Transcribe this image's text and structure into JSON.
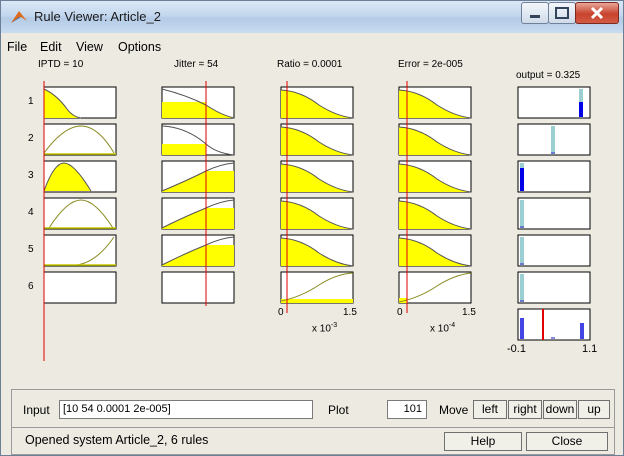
{
  "window": {
    "title": "Rule Viewer: Article_2",
    "icon": "matlab-icon",
    "controls": [
      "minimize-icon",
      "maximize-icon",
      "close-icon"
    ]
  },
  "menu": [
    "File",
    "Edit",
    "View",
    "Options"
  ],
  "inputs": [
    {
      "header": "IPTD = 10"
    },
    {
      "header": "Jitter = 54"
    },
    {
      "header": "Ratio = 0.0001"
    },
    {
      "header": "Error = 2e-005"
    }
  ],
  "output": {
    "header": "output = 0.325"
  },
  "rules": [
    "1",
    "2",
    "3",
    "4",
    "5",
    "6"
  ],
  "axes": {
    "ratio": {
      "min": "0",
      "max": "1.5",
      "exp_base": "x 10",
      "exp": "-3"
    },
    "error": {
      "min": "0",
      "max": "1.5",
      "exp_base": "x 10",
      "exp": "-4"
    },
    "output": {
      "min": "-0.1",
      "max": "1.1"
    }
  },
  "controls": {
    "input_label": "Input",
    "input_value": "[10 54 0.0001 2e-005]",
    "plot_label": "Plot",
    "plot_value": "101",
    "move_label": "Move",
    "move_buttons": [
      "left",
      "right",
      "down",
      "up"
    ]
  },
  "status": {
    "text": "Opened system Article_2, 6 rules",
    "help": "Help",
    "close": "Close"
  },
  "colors": {
    "fill": "#ffff00",
    "curve": "#6b6b1a",
    "marker": "#e00000",
    "output_bar": "#0000e6",
    "output_bar_faint": "#9ccfd2"
  }
}
